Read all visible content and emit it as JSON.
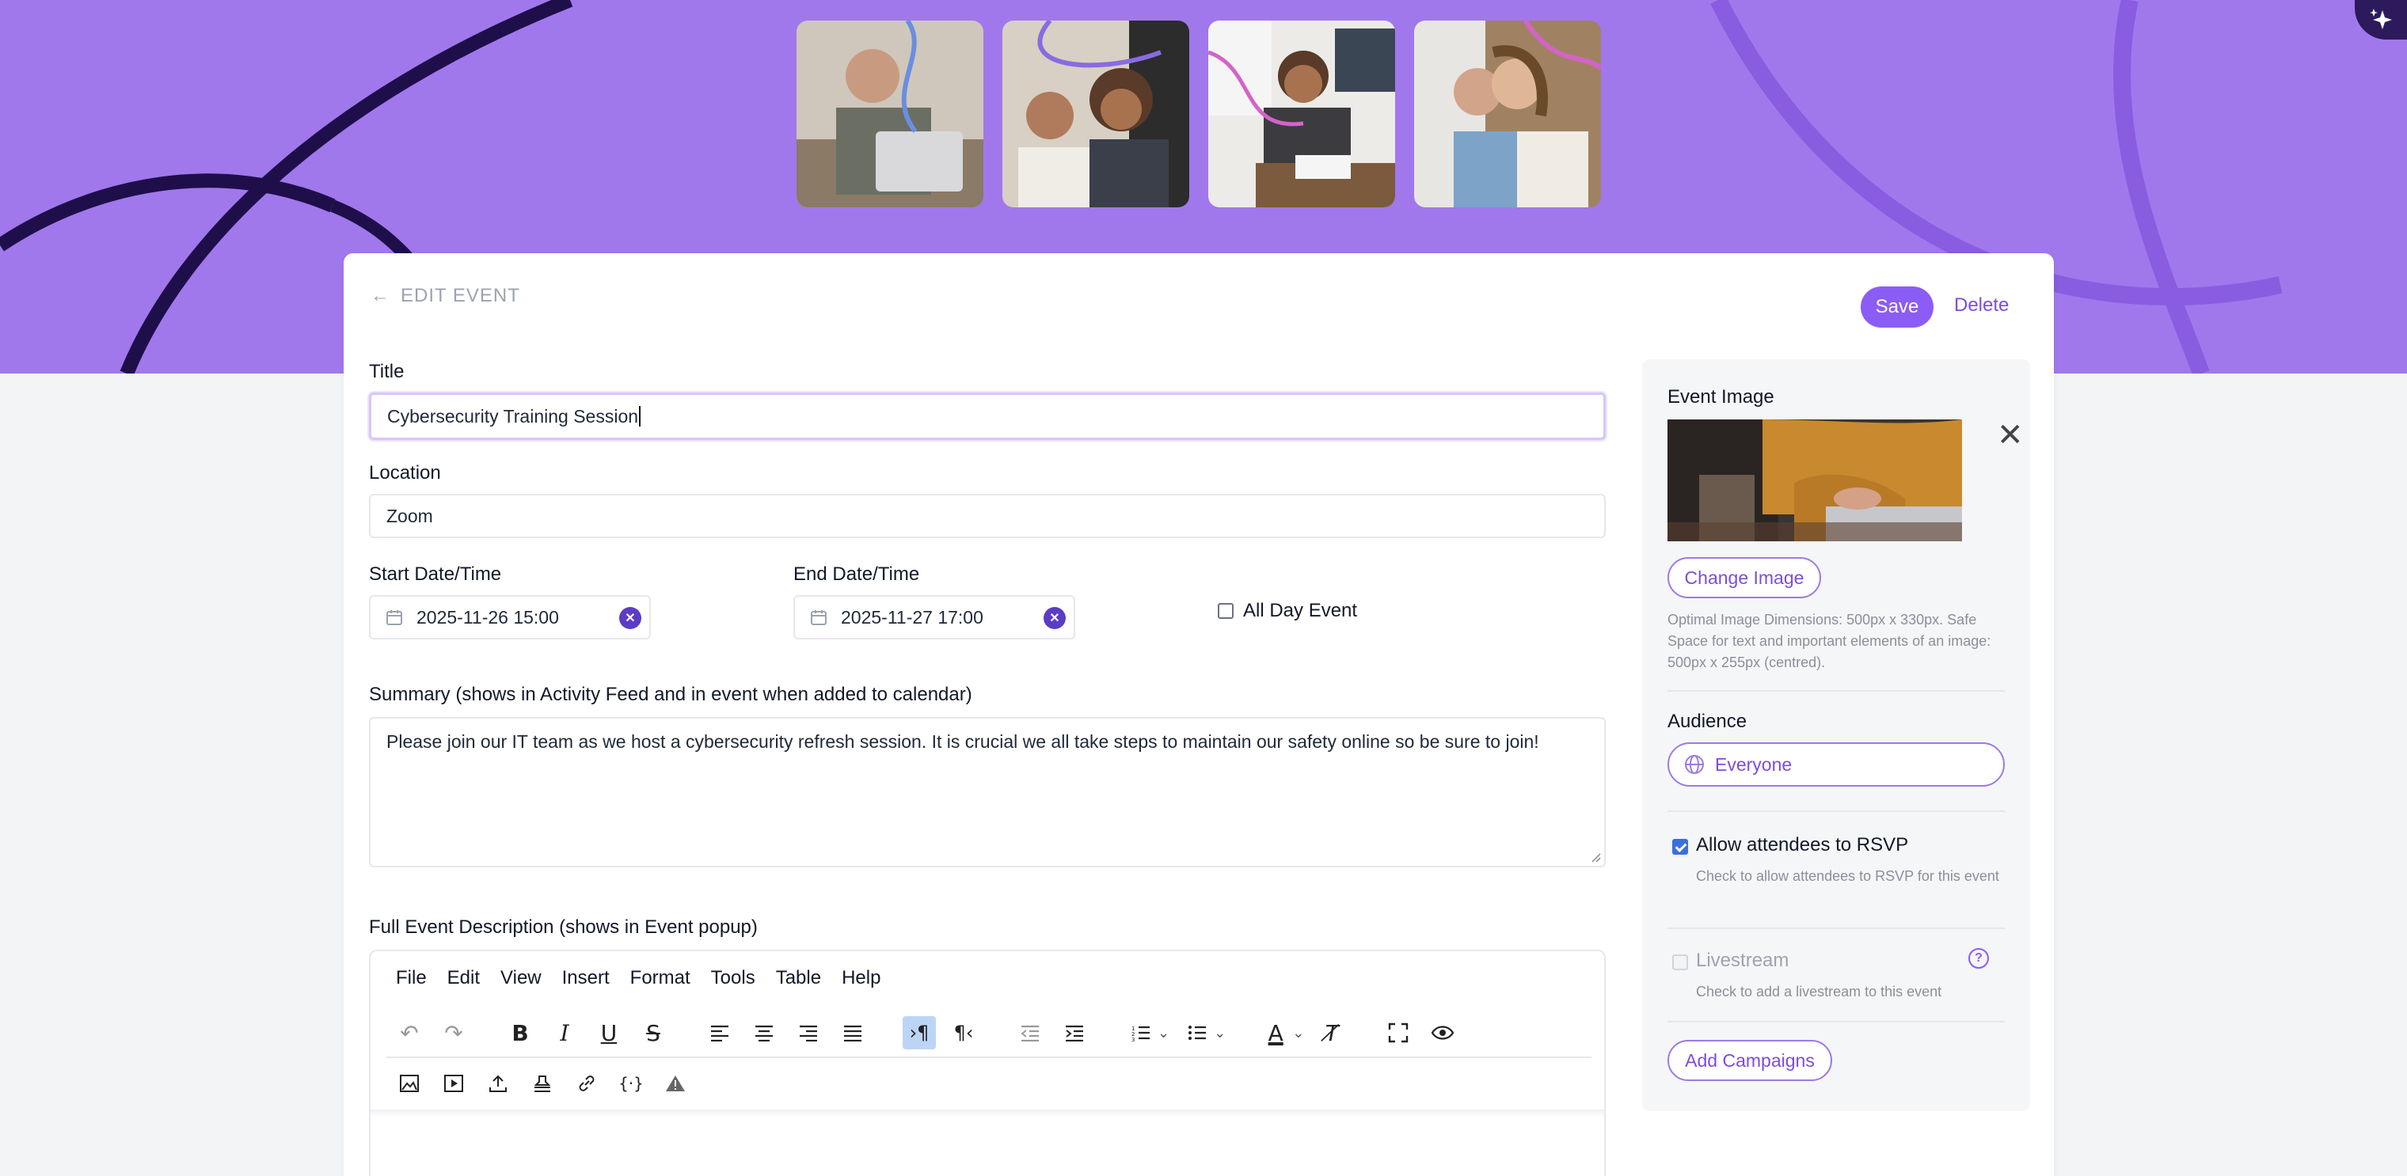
{
  "page": {
    "header_title": "EDIT EVENT",
    "save_label": "Save",
    "delete_label": "Delete"
  },
  "form": {
    "title_label": "Title",
    "title_value": "Cybersecurity Training Session",
    "location_label": "Location",
    "location_value": "Zoom",
    "start_label": "Start Date/Time",
    "start_value": "2025-11-26 15:00",
    "end_label": "End Date/Time",
    "end_value": "2025-11-27 17:00",
    "all_day_label": "All Day Event",
    "all_day_checked": false,
    "summary_label": "Summary (shows in Activity Feed and in event when added to calendar)",
    "summary_value": "Please join our IT team as we host a cybersecurity refresh session. It is crucial we all take steps to maintain our safety online so be sure to join!",
    "description_label": "Full Event Description (shows in Event popup)"
  },
  "editor": {
    "menu": [
      "File",
      "Edit",
      "View",
      "Insert",
      "Format",
      "Tools",
      "Table",
      "Help"
    ]
  },
  "sidebar": {
    "event_image_label": "Event Image",
    "change_image_label": "Change Image",
    "image_hint": "Optimal Image Dimensions: 500px x 330px. Safe Space for text and important elements of an image: 500px x 255px (centred).",
    "audience_label": "Audience",
    "audience_value": "Everyone",
    "rsvp_label": "Allow attendees to RSVP",
    "rsvp_hint": "Check to allow attendees to RSVP for this event",
    "rsvp_checked": true,
    "livestream_label": "Livestream",
    "livestream_hint": "Check to add a livestream to this event",
    "livestream_checked": false,
    "add_campaigns_label": "Add Campaigns"
  },
  "colors": {
    "banner": "#a078ec",
    "accent": "#8b5cf6",
    "clear_button": "#5b3cc4"
  }
}
